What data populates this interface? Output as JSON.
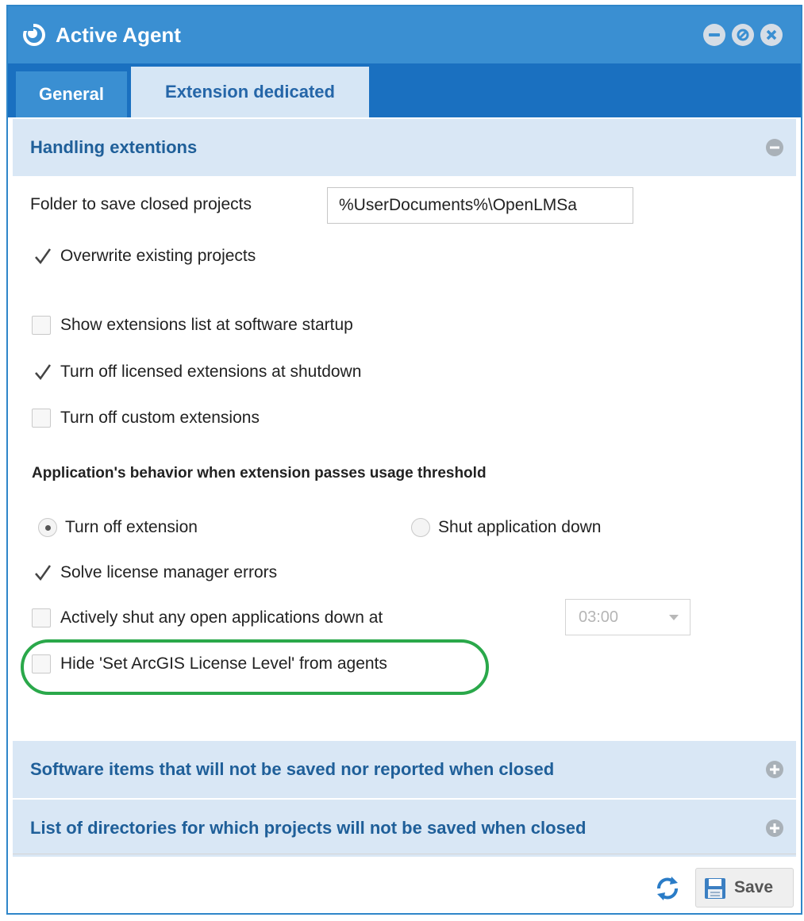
{
  "window": {
    "title": "Active Agent",
    "logo_icon": "agent-logo-icon",
    "controls": [
      "minimize-icon",
      "restore-icon",
      "close-icon"
    ]
  },
  "tabs": [
    {
      "label": "General",
      "active": false
    },
    {
      "label": "Extension dedicated",
      "active": true
    }
  ],
  "sections": {
    "handling": {
      "title": "Handling extentions",
      "expanded": true
    },
    "software_items": {
      "title": "Software items that will not be saved nor reported when closed",
      "expanded": false
    },
    "directories": {
      "title": "List of directories for which projects will not be saved when closed",
      "expanded": false
    }
  },
  "folder": {
    "label": "Folder to save closed projects",
    "value": "%UserDocuments%\\OpenLMSa"
  },
  "checkboxes": {
    "overwrite": {
      "label": "Overwrite existing projects",
      "checked": true
    },
    "show_list": {
      "label": "Show extensions list at software startup",
      "checked": false
    },
    "turn_off_licensed": {
      "label": "Turn off licensed extensions at shutdown",
      "checked": true
    },
    "turn_off_custom": {
      "label": "Turn off custom extensions",
      "checked": false
    },
    "solve_errors": {
      "label": "Solve license manager errors",
      "checked": true
    },
    "actively_shut": {
      "label": "Actively shut any open applications down at",
      "checked": false
    },
    "hide_arcgis": {
      "label": "Hide 'Set ArcGIS License Level' from agents",
      "checked": false
    }
  },
  "threshold": {
    "heading": "Application's behavior when extension passes usage threshold",
    "options": [
      {
        "label": "Turn off extension",
        "selected": true
      },
      {
        "label": "Shut application down",
        "selected": false
      }
    ]
  },
  "shutdown_time": {
    "value": "03:00"
  },
  "footer": {
    "refresh_icon": "refresh-icon",
    "save_label": "Save",
    "save_icon": "floppy-disk-icon"
  },
  "colors": {
    "titlebar": "#3a8fd2",
    "tabbar": "#1a70c0",
    "section_header_bg": "#d9e7f5",
    "section_title": "#1f5f99",
    "highlight": "#2aa84a"
  }
}
